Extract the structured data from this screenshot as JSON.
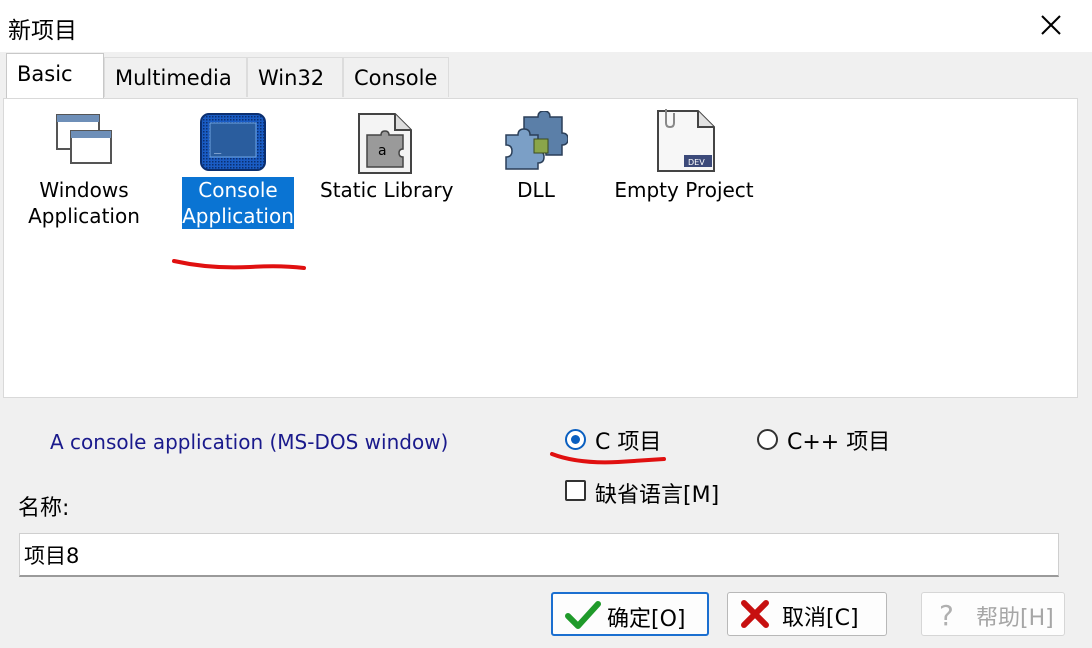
{
  "window": {
    "title": "新项目"
  },
  "tabs": [
    "Basic",
    "Multimedia",
    "Win32",
    "Console"
  ],
  "projects": [
    {
      "line1": "Windows",
      "line2": "Application",
      "icon": "windows-app-icon"
    },
    {
      "line1": "Console",
      "line2": "Application",
      "icon": "console-app-icon",
      "selected": true
    },
    {
      "line1": "Static Library",
      "icon": "static-library-icon"
    },
    {
      "line1": "DLL",
      "icon": "dll-icon"
    },
    {
      "line1": "Empty Project",
      "icon": "empty-project-icon"
    }
  ],
  "description": "A console application (MS-DOS window)",
  "language": {
    "c_label": "C 项目",
    "cpp_label": "C++ 项目",
    "selected": "C 项目"
  },
  "default_language_label": "缺省语言[M]",
  "name": {
    "label": "名称:",
    "value": "项目8"
  },
  "buttons": {
    "ok": "确定[O]",
    "cancel": "取消[C]",
    "help": "帮助[H]"
  },
  "colors": {
    "selection": "#0a74d3",
    "annotation": "#e01010",
    "description_text": "#1a1a8c"
  }
}
